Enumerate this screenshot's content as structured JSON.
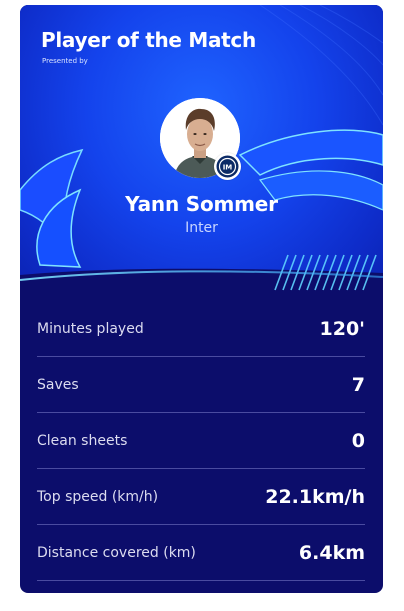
{
  "header": {
    "title": "Player of the Match",
    "presented_by": "Presented by"
  },
  "player": {
    "name": "Yann Sommer",
    "club": "Inter"
  },
  "stats": [
    {
      "label": "Minutes played",
      "value": "120'"
    },
    {
      "label": "Saves",
      "value": "7"
    },
    {
      "label": "Clean sheets",
      "value": "0"
    },
    {
      "label": "Top speed (km/h)",
      "value": "22.1km/h"
    },
    {
      "label": "Distance covered (km)",
      "value": "6.4km"
    }
  ],
  "colors": {
    "hero_blue": "#1443ec",
    "stats_navy": "#0c0d6b",
    "accent_cyan": "#5fd3ff",
    "text_white": "#ffffff"
  }
}
